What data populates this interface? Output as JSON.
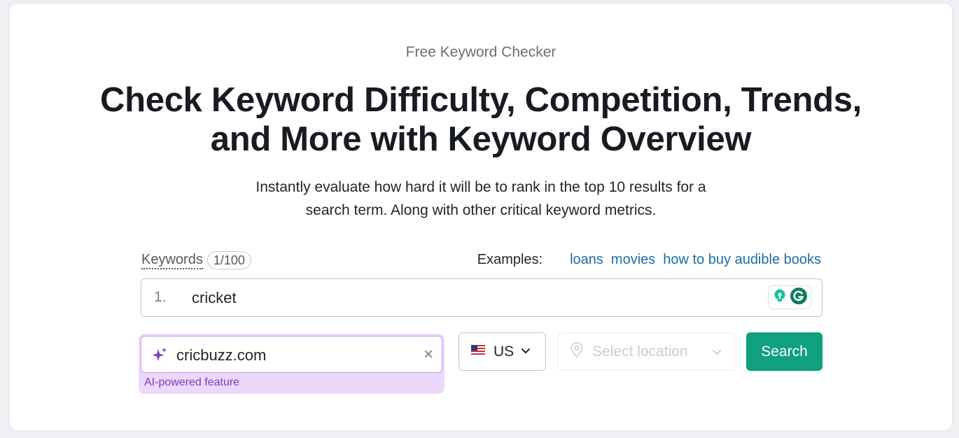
{
  "header": {
    "eyebrow": "Free Keyword Checker",
    "headline_line1": "Check Keyword Difficulty, Competition, Trends,",
    "headline_line2": "and More with Keyword Overview",
    "subtext_line1": "Instantly evaluate how hard it will be to rank in the top 10 results for a",
    "subtext_line2": "search term. Along with other critical keyword metrics."
  },
  "keywords": {
    "label": "Keywords",
    "count": "1/100",
    "examples_label": "Examples:",
    "examples": [
      "loans",
      "movies",
      "how to buy audible books"
    ],
    "rows": [
      {
        "number": "1.",
        "value": "cricket"
      }
    ]
  },
  "domain": {
    "value": "cricbuzz.com",
    "clear": "×",
    "note": "AI-powered feature"
  },
  "country": {
    "code": "US",
    "flag": "us-flag-icon"
  },
  "location": {
    "placeholder": "Select location"
  },
  "actions": {
    "search_label": "Search"
  },
  "colors": {
    "accent": "#109f7f",
    "link": "#1a6ea8",
    "ai_purple": "#7b3fb8",
    "ai_bg": "#ecd8fb"
  }
}
